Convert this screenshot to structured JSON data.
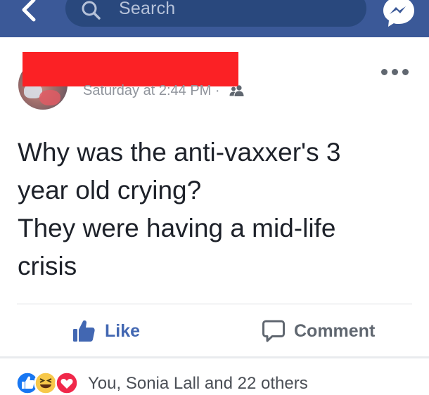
{
  "header": {
    "search": {
      "placeholder": "Search"
    },
    "icons": [
      "back-chevron-icon",
      "search-icon",
      "messenger-icon"
    ],
    "brand_color": "#3b5998",
    "search_bg_color": "#29487d"
  },
  "post": {
    "meta": {
      "timestamp": "Saturday at 2:44 PM",
      "separator": " · ",
      "audience_icon": "friends-icon"
    },
    "text_lines": [
      "Why was the anti-vaxxer's 3",
      "year old crying?",
      "They were having a mid-life",
      "crisis"
    ],
    "redaction_color": "#fb2125"
  },
  "actions": {
    "like_label": "Like",
    "comment_label": "Comment",
    "like_color": "#4267b2"
  },
  "reactions": {
    "types": [
      "like",
      "haha",
      "love"
    ],
    "summary": "You, Sonia Lall and 22 others"
  }
}
